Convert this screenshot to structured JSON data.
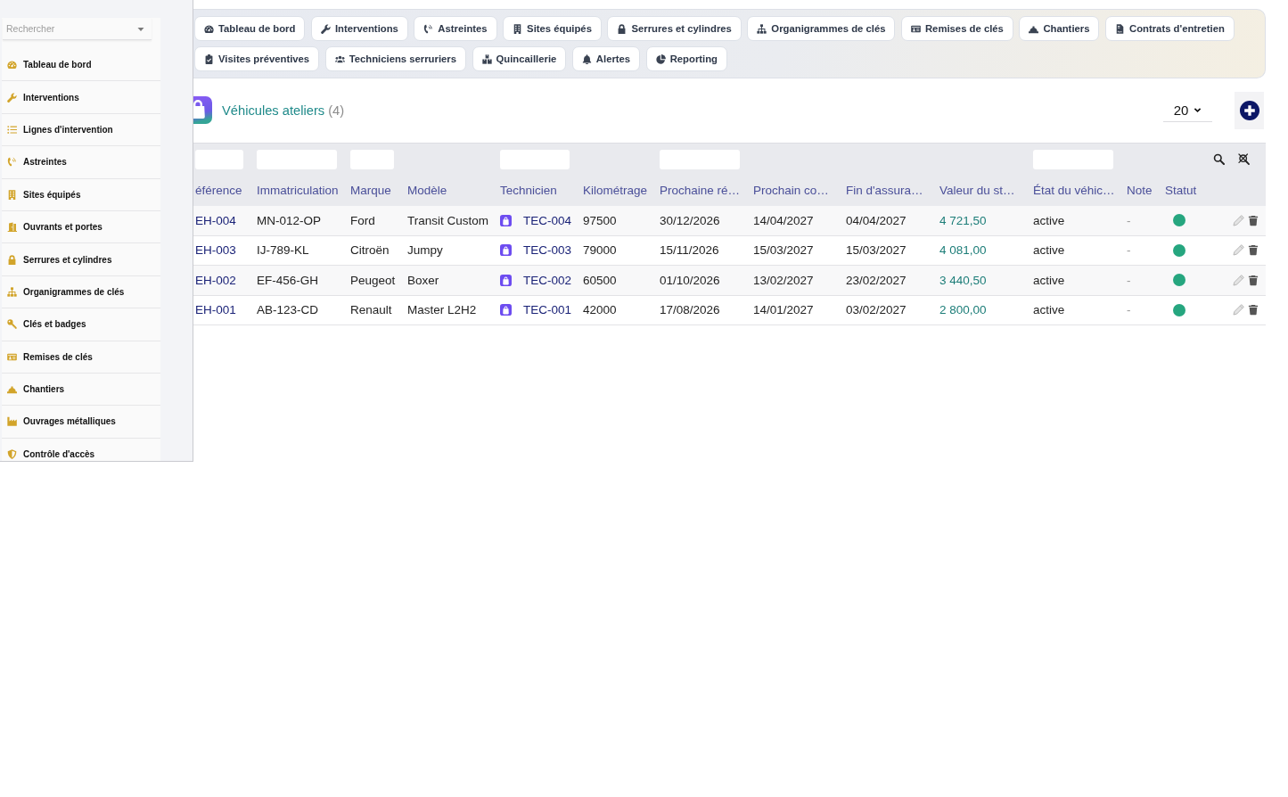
{
  "sidebar": {
    "search": {
      "placeholder": "Rechercher"
    },
    "items": [
      {
        "label": "Tableau de bord",
        "kind": "gauge"
      },
      {
        "label": "Interventions",
        "kind": "wrench"
      },
      {
        "label": "Lignes d'intervention",
        "kind": "list"
      },
      {
        "label": "Astreintes",
        "kind": "phone"
      },
      {
        "label": "Sites équipés",
        "kind": "building"
      },
      {
        "label": "Ouvrants et portes",
        "kind": "door"
      },
      {
        "label": "Serrures et cylindres",
        "kind": "padlock"
      },
      {
        "label": "Organigrammes de clés",
        "kind": "hierarchy"
      },
      {
        "label": "Clés et badges",
        "kind": "key"
      },
      {
        "label": "Remises de clés",
        "kind": "id-card"
      },
      {
        "label": "Chantiers",
        "kind": "hard-hat"
      },
      {
        "label": "Ouvrages métalliques",
        "kind": "factory"
      },
      {
        "label": "Contrôle d'accès",
        "kind": "shield"
      }
    ]
  },
  "nav_tabs": [
    {
      "label": "Tableau de bord",
      "kind": "gauge"
    },
    {
      "label": "Interventions",
      "kind": "wrench"
    },
    {
      "label": "Astreintes",
      "kind": "phone"
    },
    {
      "label": "Sites équipés",
      "kind": "building"
    },
    {
      "label": "Serrures et cylindres",
      "kind": "padlock"
    },
    {
      "label": "Organigrammes de clés",
      "kind": "hierarchy"
    },
    {
      "label": "Remises de clés",
      "kind": "id-card"
    },
    {
      "label": "Chantiers",
      "kind": "hard-hat"
    },
    {
      "label": "Contrats d'entretien",
      "kind": "document"
    },
    {
      "label": "Visites préventives",
      "kind": "clipboard-check"
    },
    {
      "label": "Techniciens serruriers",
      "kind": "people"
    },
    {
      "label": "Quincaillerie",
      "kind": "boxes"
    },
    {
      "label": "Alertes",
      "kind": "bell"
    },
    {
      "label": "Reporting",
      "kind": "pie-chart"
    }
  ],
  "header": {
    "title": "Véhicules ateliers",
    "count": "(4)",
    "page_size": "20"
  },
  "table": {
    "columns": [
      {
        "label": "éférence",
        "kind": "link",
        "filter": true
      },
      {
        "label": "Immatriculation",
        "kind": "text",
        "filter": true
      },
      {
        "label": "Marque",
        "kind": "text",
        "filter": true
      },
      {
        "label": "Modèle",
        "kind": "text",
        "filter": false
      },
      {
        "label": "Technicien",
        "kind": "technician",
        "filter": true
      },
      {
        "label": "Kilométrage",
        "kind": "text",
        "filter": false
      },
      {
        "label": "Prochaine ré…",
        "kind": "text",
        "filter": true
      },
      {
        "label": "Prochain co…",
        "kind": "text",
        "filter": false
      },
      {
        "label": "Fin d'assura…",
        "kind": "text",
        "filter": false
      },
      {
        "label": "Valeur du st…",
        "kind": "money",
        "filter": false
      },
      {
        "label": "État du véhic…",
        "kind": "text",
        "filter": true
      },
      {
        "label": "Note",
        "kind": "muted",
        "filter": false
      },
      {
        "label": "Statut",
        "kind": "status",
        "filter": false
      }
    ],
    "rows": [
      {
        "cells": [
          "EH-004",
          "MN-012-OP",
          "Ford",
          "Transit Custom",
          "TEC-004",
          "97500",
          "30/12/2026",
          "14/04/2027",
          "04/04/2027",
          "4 721,50",
          "active",
          "-"
        ],
        "status": {
          "color": "#26a67f"
        }
      },
      {
        "cells": [
          "EH-003",
          "IJ-789-KL",
          "Citroën",
          "Jumpy",
          "TEC-003",
          "79000",
          "15/11/2026",
          "15/03/2027",
          "15/03/2027",
          "4 081,00",
          "active",
          "-"
        ],
        "status": {
          "color": "#26a67f"
        }
      },
      {
        "cells": [
          "EH-002",
          "EF-456-GH",
          "Peugeot",
          "Boxer",
          "TEC-002",
          "60500",
          "01/10/2026",
          "13/02/2027",
          "23/02/2027",
          "3 440,50",
          "active",
          "-"
        ],
        "status": {
          "color": "#26a67f"
        }
      },
      {
        "cells": [
          "EH-001",
          "AB-123-CD",
          "Renault",
          "Master L2H2",
          "TEC-001",
          "42000",
          "17/08/2026",
          "14/01/2027",
          "03/02/2027",
          "2 800,00",
          "active",
          "-"
        ],
        "status": {
          "color": "#26a67f"
        }
      }
    ]
  }
}
